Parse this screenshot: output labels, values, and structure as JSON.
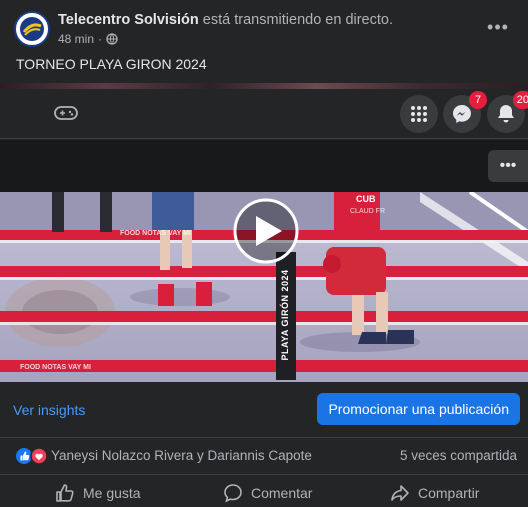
{
  "header": {
    "author": "Telecentro Solvisión",
    "action_text": "está transmitiendo en directo.",
    "time": "48 min",
    "separator": "·",
    "audience_icon": "globe-icon",
    "logo_text": "SOLVISION"
  },
  "post": {
    "text": "TORNEO PLAYA GIRON 2024"
  },
  "toolbar": {
    "game_icon": "gamepad-icon",
    "apps_icon": "grid-icon",
    "messenger_badge": "7",
    "notifications_badge": "20"
  },
  "video": {
    "banner_text": "PLAYA GIRÓN 2024",
    "rope_text": "FOOD NOTAS VAY MI",
    "corner_shirt_text": "CUB",
    "shirt_subtext": "CLAUD FR"
  },
  "footer": {
    "insights_label": "Ver insights",
    "promote_label": "Promocionar una publicación"
  },
  "reactions": {
    "names": "Yaneysi Nolazco Rivera y Dariannis Capote",
    "shares": "5 veces compartida"
  },
  "actions": {
    "like": "Me gusta",
    "comment": "Comentar",
    "share": "Compartir"
  },
  "colors": {
    "background": "#242526",
    "accent": "#1b74e4",
    "link": "#4599ff",
    "badge": "#e41e3f"
  }
}
